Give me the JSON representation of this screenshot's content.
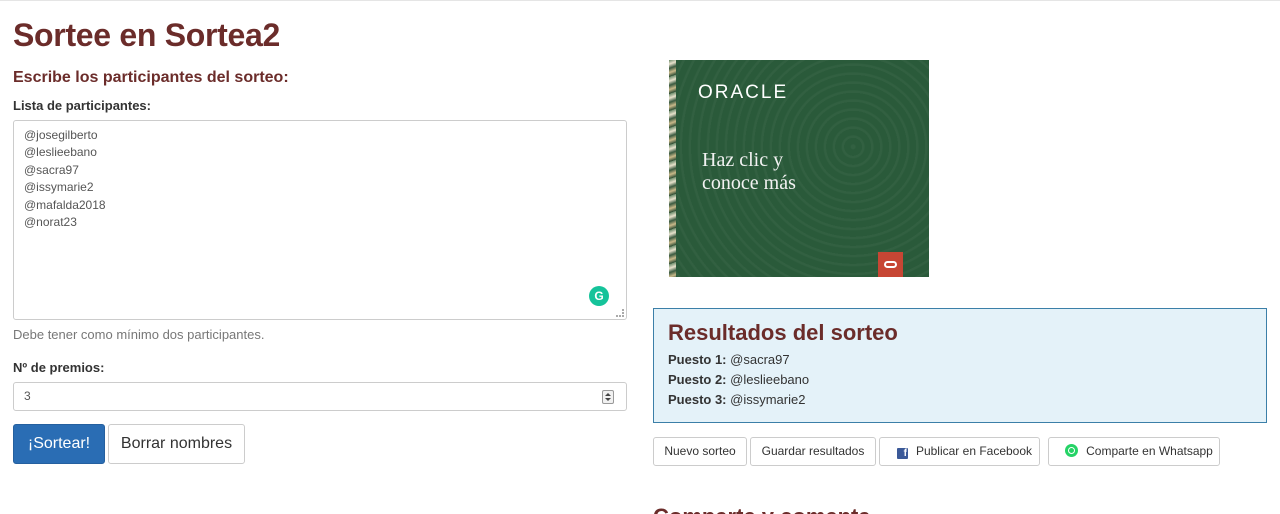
{
  "page": {
    "title": "Sortee en Sortea2",
    "subtitle": "Escribe los participantes del sorteo:"
  },
  "form": {
    "participants_label": "Lista de participantes:",
    "participants": [
      "@josegilberto",
      "@leslieebano",
      "@sacra97",
      "@issymarie2",
      "@mafalda2018",
      "@norat23"
    ],
    "participants_help": "Debe tener como mínimo dos participantes.",
    "prizes_label": "Nº de premios:",
    "prizes_value": "3",
    "draw_button": "¡Sortear!",
    "clear_button": "Borrar nombres"
  },
  "ad": {
    "logo": "ORACLE",
    "line1": "Haz clic y",
    "line2": "conoce más"
  },
  "results": {
    "title": "Resultados del sorteo",
    "rows": [
      {
        "label": "Puesto 1:",
        "value": "@sacra97"
      },
      {
        "label": "Puesto 2:",
        "value": "@leslieebano"
      },
      {
        "label": "Puesto 3:",
        "value": "@issymarie2"
      }
    ]
  },
  "actions": {
    "new_draw": "Nuevo sorteo",
    "save_results": "Guardar resultados",
    "publish_facebook": "Publicar en Facebook",
    "share_whatsapp": "Comparte en Whatsapp"
  },
  "next_section": {
    "heading": "Comparte y comenta"
  },
  "colors": {
    "heading": "#6b2c2a",
    "primary": "#2a6db4",
    "results_bg": "#e4f2f9",
    "ad_bg": "#2a5a3a"
  }
}
